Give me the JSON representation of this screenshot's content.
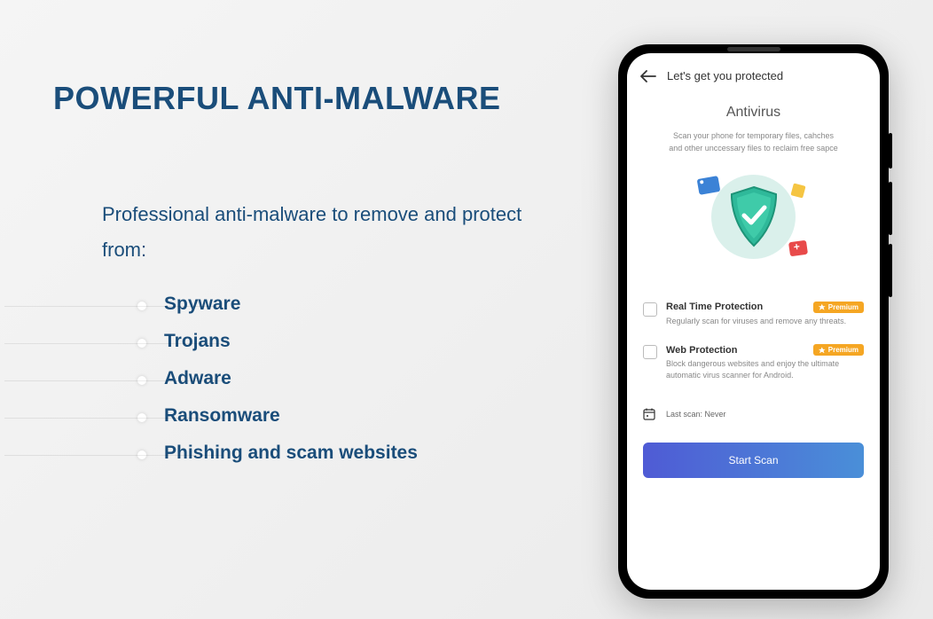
{
  "left": {
    "heading": "POWERFUL ANTI-MALWARE",
    "subheading": "Professional anti-malware to remove and protect from:",
    "bullets": [
      "Spyware",
      "Trojans",
      "Adware",
      "Ransomware",
      "Phishing and scam websites"
    ]
  },
  "phone": {
    "header_title": "Let's get you protected",
    "section_title": "Antivirus",
    "section_desc_line1": "Scan your phone for temporary files, cahches",
    "section_desc_line2": "and other unccessary files to reclaim free sapce",
    "features": [
      {
        "title": "Real Time Protection",
        "desc": "Regularly scan for viruses and remove any threats.",
        "badge": "Premium"
      },
      {
        "title": "Web Protection",
        "desc": "Block dangerous websites and enjoy the ultimate automatic virus scanner for Android.",
        "badge": "Premium"
      }
    ],
    "last_scan": "Last scan: Never",
    "button": "Start Scan"
  }
}
